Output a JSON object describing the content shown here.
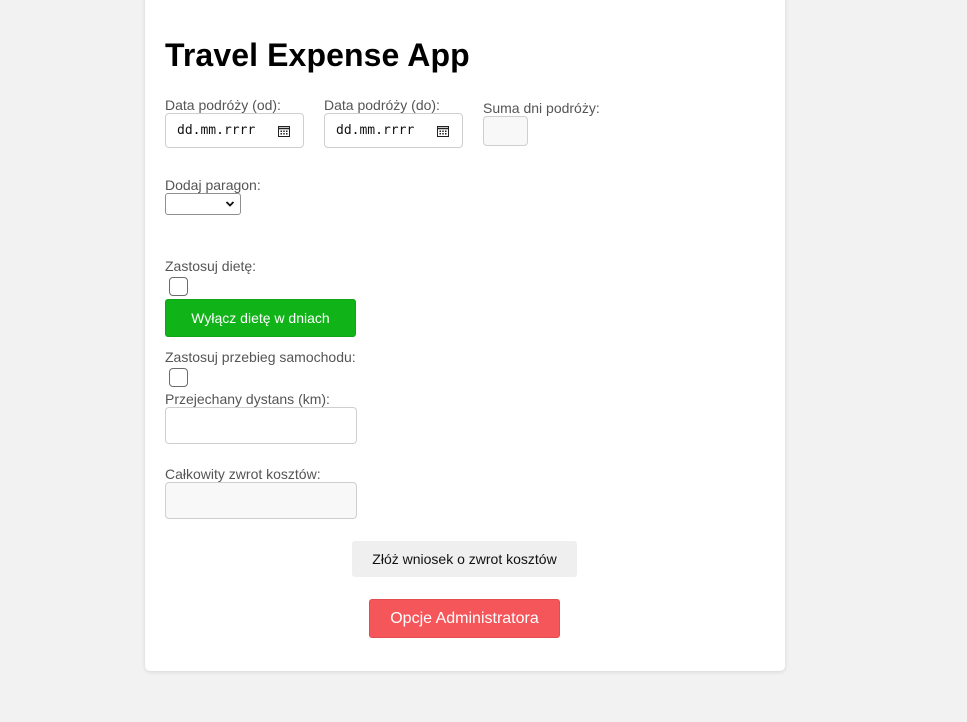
{
  "app": {
    "title": "Travel Expense App"
  },
  "dates": {
    "from_label": "Data podróży (od):",
    "from_placeholder": "dd.mm.rrrr",
    "to_label": "Data podróży (do):",
    "to_placeholder": "dd.mm.rrrr",
    "days_label": "Suma dni podróży:",
    "days_value": ""
  },
  "receipt": {
    "label": "Dodaj paragon:",
    "selected": ""
  },
  "diet": {
    "label": "Zastosuj dietę:",
    "checked": false,
    "exclude_button": "Wyłącz dietę w dniach"
  },
  "mileage": {
    "label": "Zastosuj przebieg samochodu:",
    "checked": false,
    "distance_label": "Przejechany dystans (km):",
    "distance_value": ""
  },
  "total": {
    "label": "Całkowity zwrot kosztów:",
    "value": ""
  },
  "actions": {
    "submit_label": "Złóż wniosek o zwrot kosztów",
    "admin_label": "Opcje Administratora"
  },
  "colors": {
    "page_background": "#f2f2f2",
    "card_background": "#ffffff",
    "green_button": "#10b418",
    "red_button": "#f5565a",
    "gray_button": "#efefef"
  }
}
